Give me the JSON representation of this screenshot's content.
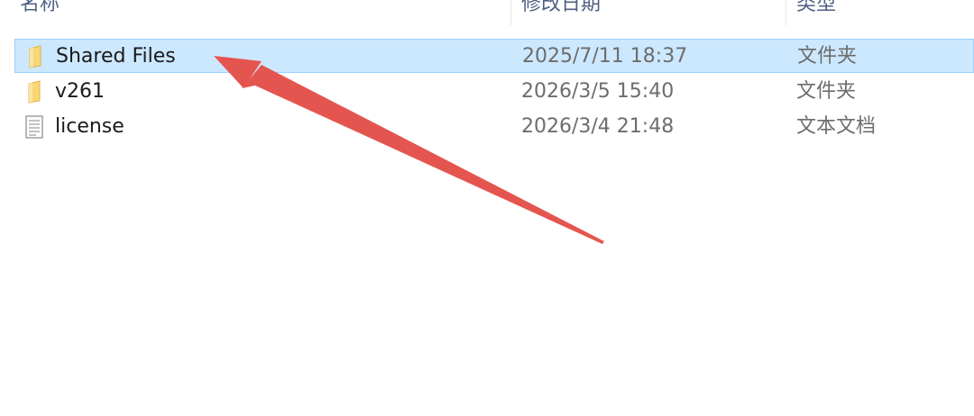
{
  "columns": {
    "name": "名称",
    "date_modified": "修改日期",
    "type": "类型"
  },
  "files": [
    {
      "name": "Shared Files",
      "date": "2025/7/11 18:37",
      "type": "文件夹",
      "icon": "folder-icon",
      "selected": true
    },
    {
      "name": "v261",
      "date": "2026/3/5 15:40",
      "type": "文件夹",
      "icon": "folder-icon",
      "selected": false
    },
    {
      "name": "license",
      "date": "2026/3/4 21:48",
      "type": "文本文档",
      "icon": "text-document-icon",
      "selected": false
    }
  ],
  "colors": {
    "selection_bg": "#cce8ff",
    "selection_border": "#99d1ff",
    "folder": "#f8d775",
    "arrow": "#e5554f"
  }
}
